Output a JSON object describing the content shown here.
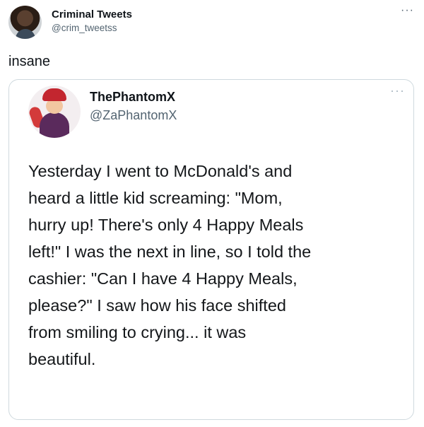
{
  "outer_tweet": {
    "author_name": "Criminal Tweets",
    "author_handle": "@crim_tweetss",
    "more_icon": "ellipsis-icon",
    "text": "insane"
  },
  "quoted_tweet": {
    "author_name": "ThePhantomX",
    "author_handle": "@ZaPhantomX",
    "more_icon": "ellipsis-icon",
    "text_lines": [
      "Yesterday I went to McDonald's and",
      "heard a little kid screaming: \"Mom,",
      "hurry up! There's only 4 Happy Meals",
      "left!\" I was the next in line, so I told the",
      "cashier: \"Can I have 4 Happy Meals,",
      "please?\" I saw how his face shifted",
      "from smiling to crying... it was",
      "beautiful."
    ]
  },
  "colors": {
    "text_primary": "#0f1419",
    "text_secondary": "#536471",
    "card_border": "#cfd9de"
  }
}
